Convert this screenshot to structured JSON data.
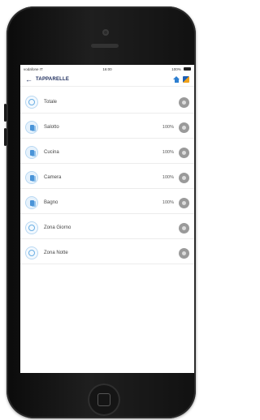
{
  "status_bar": {
    "carrier": "vodafone IT",
    "time": "16:00",
    "battery": "100%"
  },
  "header": {
    "back_icon": "back-arrow-icon",
    "title": "TAPPARELLE",
    "home_icon": "home-icon",
    "brand_icon": "brand-logo-icon"
  },
  "rows": [
    {
      "label": "Totale",
      "value": "",
      "icon": "zone-icon"
    },
    {
      "label": "Salotto",
      "value": "100%",
      "icon": "shutter-icon"
    },
    {
      "label": "Cucina",
      "value": "100%",
      "icon": "shutter-icon"
    },
    {
      "label": "Camera",
      "value": "100%",
      "icon": "shutter-icon"
    },
    {
      "label": "Bagno",
      "value": "100%",
      "icon": "shutter-icon"
    },
    {
      "label": "Zona Giorno",
      "value": "",
      "icon": "zone-icon"
    },
    {
      "label": "Zona Notte",
      "value": "",
      "icon": "zone-icon"
    }
  ],
  "colors": {
    "accent": "#2d7fd1",
    "title": "#1a2a5a",
    "action": "#9a9a9a"
  }
}
